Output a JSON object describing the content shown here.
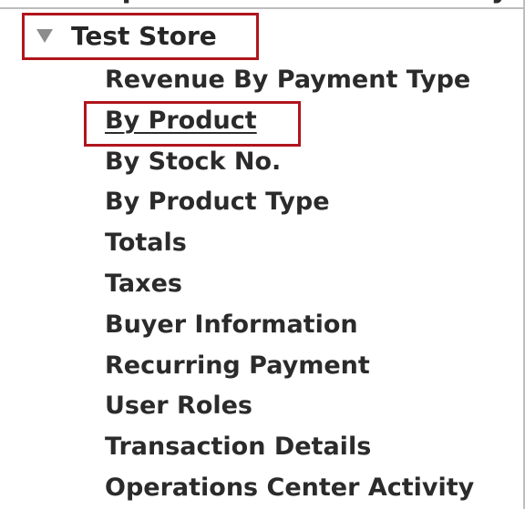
{
  "tree": {
    "store": {
      "label": "Test Store",
      "expanded": true,
      "icon": "expanded-triangle-icon"
    },
    "reports": [
      {
        "label": "Revenue By Payment Type",
        "active": false
      },
      {
        "label": "By Product",
        "active": true
      },
      {
        "label": "By Stock No.",
        "active": false
      },
      {
        "label": "By Product Type",
        "active": false
      },
      {
        "label": "Totals",
        "active": false
      },
      {
        "label": "Taxes",
        "active": false
      },
      {
        "label": "Buyer Information",
        "active": false
      },
      {
        "label": "Recurring Payment",
        "active": false
      },
      {
        "label": "User Roles",
        "active": false
      },
      {
        "label": "Transaction Details",
        "active": false
      },
      {
        "label": "Operations Center Activity",
        "active": false
      }
    ]
  },
  "colors": {
    "highlight": "#b0151d",
    "text": "#2b2b2b",
    "triangle": "#8c8c8c"
  }
}
